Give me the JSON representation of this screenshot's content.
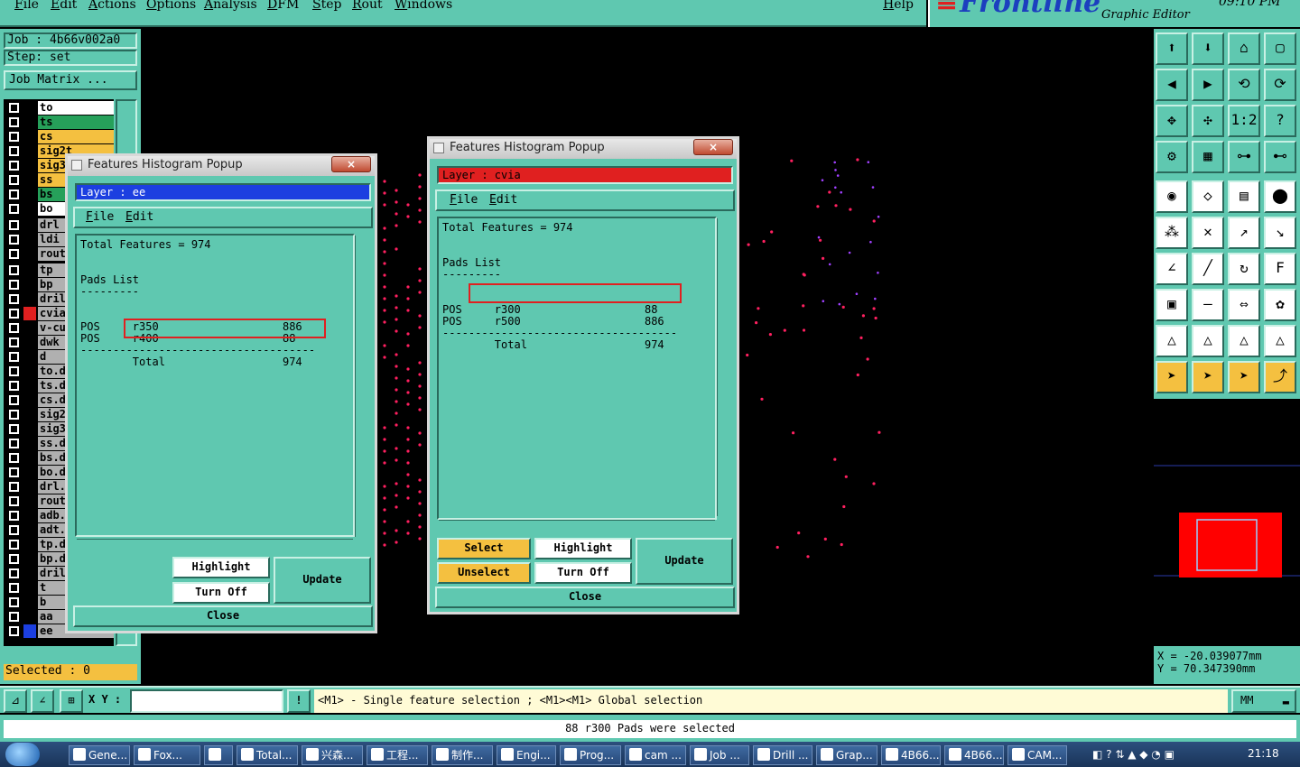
{
  "menubar": {
    "items": [
      "File",
      "Edit",
      "Actions",
      "Options",
      "Analysis",
      "DFM",
      "Step",
      "Rout",
      "Windows"
    ],
    "help": "Help"
  },
  "logo": {
    "brand": "Frontline",
    "subtitle": "Graphic Editor",
    "time": "09:10 PM"
  },
  "left": {
    "job": "Job : 4b66v002a0",
    "step": "Step: set",
    "job_matrix": "Job Matrix ...",
    "layers": [
      {
        "name": "to",
        "color": "#ffffff",
        "bg": "#ffffff"
      },
      {
        "name": "ts",
        "color": "#26a05a",
        "bg": "#26a05a"
      },
      {
        "name": "cs",
        "color": "#f4c040",
        "bg": "#f4c040"
      },
      {
        "name": "sig2t",
        "color": "#f4c040",
        "bg": "#f4c040"
      },
      {
        "name": "sig3",
        "color": "#f4c040",
        "bg": "#f4c040"
      },
      {
        "name": "ss",
        "color": "#f4c040",
        "bg": "#f4c040"
      },
      {
        "name": "bs",
        "color": "#26a05a",
        "bg": "#26a05a"
      },
      {
        "name": "bo",
        "color": "#ffffff",
        "bg": "#ffffff"
      },
      {
        "name": "drl",
        "color": "#b0b0b0",
        "bg": "#b0b0b0"
      },
      {
        "name": "ldi",
        "color": "#b0b0b0",
        "bg": "#b0b0b0"
      },
      {
        "name": "rout",
        "color": "#b0b0b0",
        "bg": "#b0b0b0"
      },
      {
        "name": "tp",
        "color": "#b0b0b0",
        "bg": "#b0b0b0"
      },
      {
        "name": "bp",
        "color": "#b0b0b0",
        "bg": "#b0b0b0"
      },
      {
        "name": "dril",
        "color": "#b0b0b0",
        "bg": "#b0b0b0"
      },
      {
        "name": "cvia",
        "color": "#e02020",
        "bg": "#b0b0b0"
      },
      {
        "name": "v-cu",
        "color": "#b0b0b0",
        "bg": "#b0b0b0"
      },
      {
        "name": "dwk",
        "color": "#b0b0b0",
        "bg": "#b0b0b0"
      },
      {
        "name": "d",
        "color": "#b0b0b0",
        "bg": "#b0b0b0"
      },
      {
        "name": "to.d",
        "color": "#b0b0b0",
        "bg": "#b0b0b0"
      },
      {
        "name": "ts.d",
        "color": "#b0b0b0",
        "bg": "#b0b0b0"
      },
      {
        "name": "cs.d",
        "color": "#b0b0b0",
        "bg": "#b0b0b0"
      },
      {
        "name": "sig2",
        "color": "#b0b0b0",
        "bg": "#b0b0b0"
      },
      {
        "name": "sig3",
        "color": "#b0b0b0",
        "bg": "#b0b0b0"
      },
      {
        "name": "ss.d",
        "color": "#b0b0b0",
        "bg": "#b0b0b0"
      },
      {
        "name": "bs.d",
        "color": "#b0b0b0",
        "bg": "#b0b0b0"
      },
      {
        "name": "bo.d",
        "color": "#b0b0b0",
        "bg": "#b0b0b0"
      },
      {
        "name": "drl.",
        "color": "#b0b0b0",
        "bg": "#b0b0b0"
      },
      {
        "name": "rout",
        "color": "#b0b0b0",
        "bg": "#b0b0b0"
      },
      {
        "name": "adb.",
        "color": "#b0b0b0",
        "bg": "#b0b0b0"
      },
      {
        "name": "adt.",
        "color": "#b0b0b0",
        "bg": "#b0b0b0"
      },
      {
        "name": "tp.d",
        "color": "#b0b0b0",
        "bg": "#b0b0b0"
      },
      {
        "name": "bp.d",
        "color": "#b0b0b0",
        "bg": "#b0b0b0"
      },
      {
        "name": "dril",
        "color": "#b0b0b0",
        "bg": "#b0b0b0"
      },
      {
        "name": "t",
        "color": "#b0b0b0",
        "bg": "#b0b0b0"
      },
      {
        "name": "b",
        "color": "#b0b0b0",
        "bg": "#b0b0b0"
      },
      {
        "name": "aa",
        "color": "#b0b0b0",
        "bg": "#b0b0b0"
      },
      {
        "name": "ee",
        "color": "#1c3fe0",
        "bg": "#b0b0b0"
      }
    ],
    "selected": "Selected : 0"
  },
  "popup1": {
    "title": "Features Histogram Popup",
    "close_x": "×",
    "layer": "Layer :  ee",
    "layer_color": "#1c3fe0",
    "menu": [
      "File",
      "Edit"
    ],
    "lines": [
      "Total Features = 974",
      "",
      "",
      "Pads List",
      "---------",
      "",
      "",
      "POS     r350                   886",
      "POS     r400                   88",
      "------------------------------------",
      "        Total                  974"
    ],
    "buttons": {
      "highlight": "Highlight",
      "turn_off": "Turn Off",
      "update": "Update",
      "close": "Close"
    }
  },
  "popup2": {
    "title": "Features Histogram Popup",
    "close_x": "×",
    "layer": "Layer :  cvia",
    "layer_color": "#e02020",
    "menu": [
      "File",
      "Edit"
    ],
    "lines": [
      "Total Features = 974",
      "",
      "",
      "Pads List",
      "---------",
      "",
      "",
      "POS     r300                   88",
      "POS     r500                   886",
      "------------------------------------",
      "        Total                  974"
    ],
    "buttons": {
      "select": "Select",
      "highlight": "Highlight",
      "unselect": "Unselect",
      "turn_off": "Turn Off",
      "update": "Update",
      "close": "Close"
    }
  },
  "coords": {
    "x": "X  = -20.039077mm",
    "y": "Y  = 70.347390mm"
  },
  "cmd": {
    "xy_label": "X Y :",
    "xy_value": "",
    "bang": "!",
    "hint": "<M1> - Single feature selection ; <M1><M1> Global selection",
    "units": "MM"
  },
  "status": "88 r300 Pads were selected",
  "taskbar": {
    "items": [
      "Gene...",
      "Fox...",
      "",
      "Total...",
      "兴森...",
      "工程...",
      "制作...",
      "Engi...",
      "Prog...",
      "cam ...",
      "Job ...",
      "Drill ...",
      "Grap...",
      "4B66...",
      "4B66...",
      "CAM..."
    ],
    "clock": "21:18"
  }
}
